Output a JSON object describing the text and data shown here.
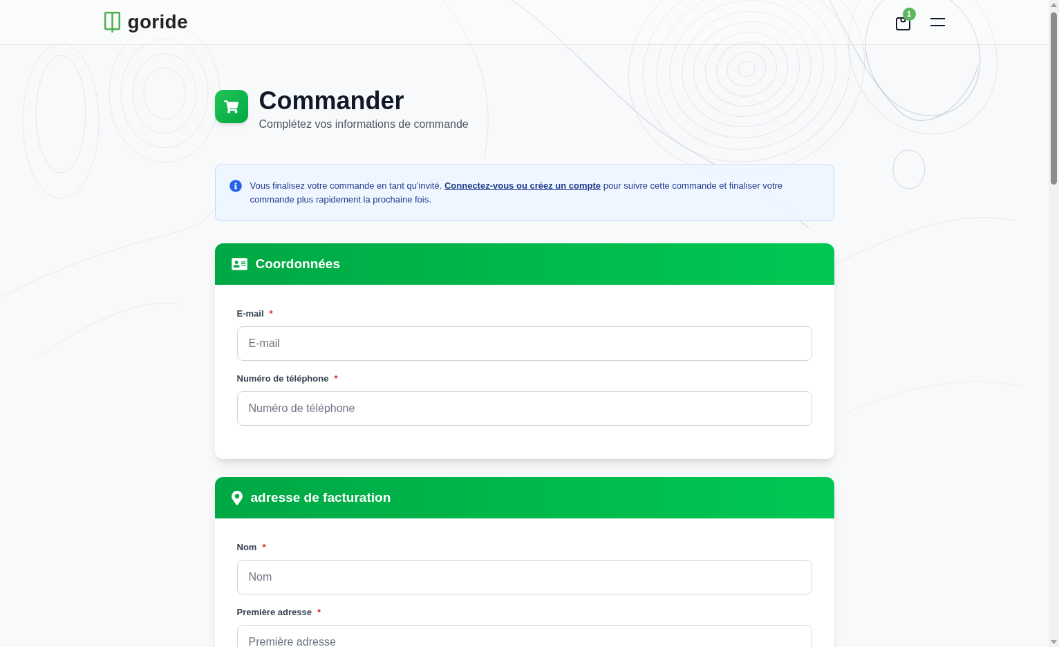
{
  "header": {
    "logo_text": "goride",
    "cart_badge": "1"
  },
  "page_heading": {
    "title": "Commander",
    "subtitle": "Complétez vos informations de commande"
  },
  "notice": {
    "text_before": "Vous finalisez votre commande en tant qu'invité.",
    "link": "Connectez-vous ou créez un compte",
    "text_after": "pour suivre cette commande et finaliser votre commande plus rapidement la prochaine fois."
  },
  "sections": [
    {
      "kind": "contact",
      "title": "Coordonnées",
      "fields": [
        {
          "label": "E-mail",
          "required_mark": "*",
          "placeholder": "E-mail"
        },
        {
          "label": "Numéro de téléphone",
          "required_mark": "*",
          "placeholder": "Numéro de téléphone"
        }
      ]
    },
    {
      "kind": "address",
      "title": "adresse de facturation",
      "fields": [
        {
          "label": "Nom",
          "required_mark": "*",
          "placeholder": "Nom"
        },
        {
          "label": "Première adresse",
          "required_mark": "*",
          "placeholder": "Première adresse"
        }
      ]
    }
  ]
}
